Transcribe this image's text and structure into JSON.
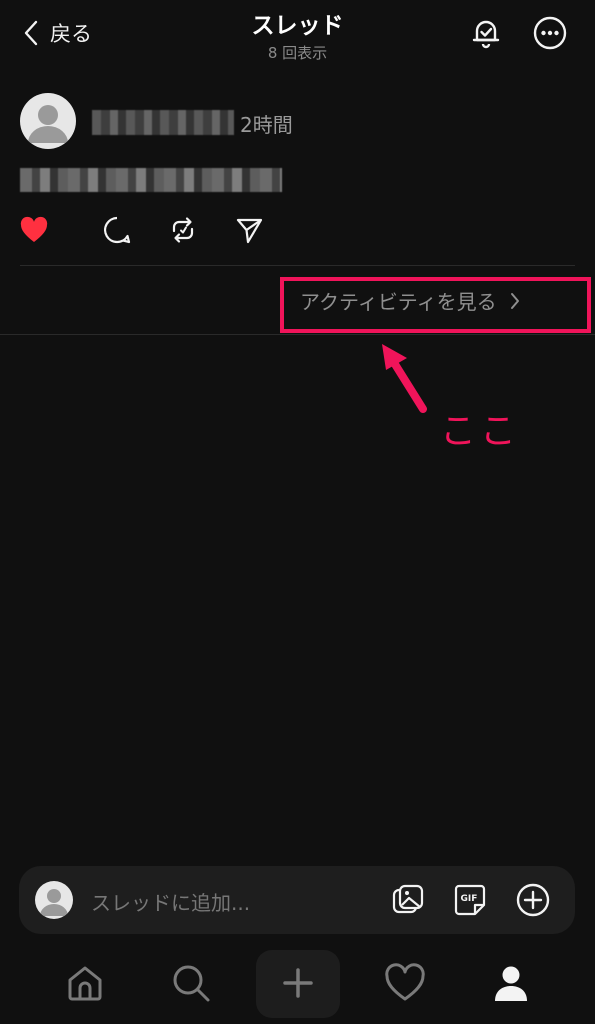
{
  "header": {
    "back_label": "戻る",
    "title": "スレッド",
    "subtitle": "8 回表示",
    "bell_icon": "bell-check-icon",
    "more_icon": "more-horizontal-icon"
  },
  "post": {
    "timestamp": "2時間",
    "actions": [
      {
        "icon": "heart-icon",
        "color": "#ff3040"
      },
      {
        "icon": "comment-icon"
      },
      {
        "icon": "repost-icon"
      },
      {
        "icon": "send-icon"
      }
    ]
  },
  "activity": {
    "label": "アクティビティを見る"
  },
  "annotation": {
    "text": "ここ",
    "color": "#f0145a"
  },
  "composer": {
    "placeholder": "スレッドに追加..."
  },
  "nav": {
    "items": [
      "home-icon",
      "search-icon",
      "plus-icon",
      "heart-icon",
      "profile-icon"
    ]
  }
}
